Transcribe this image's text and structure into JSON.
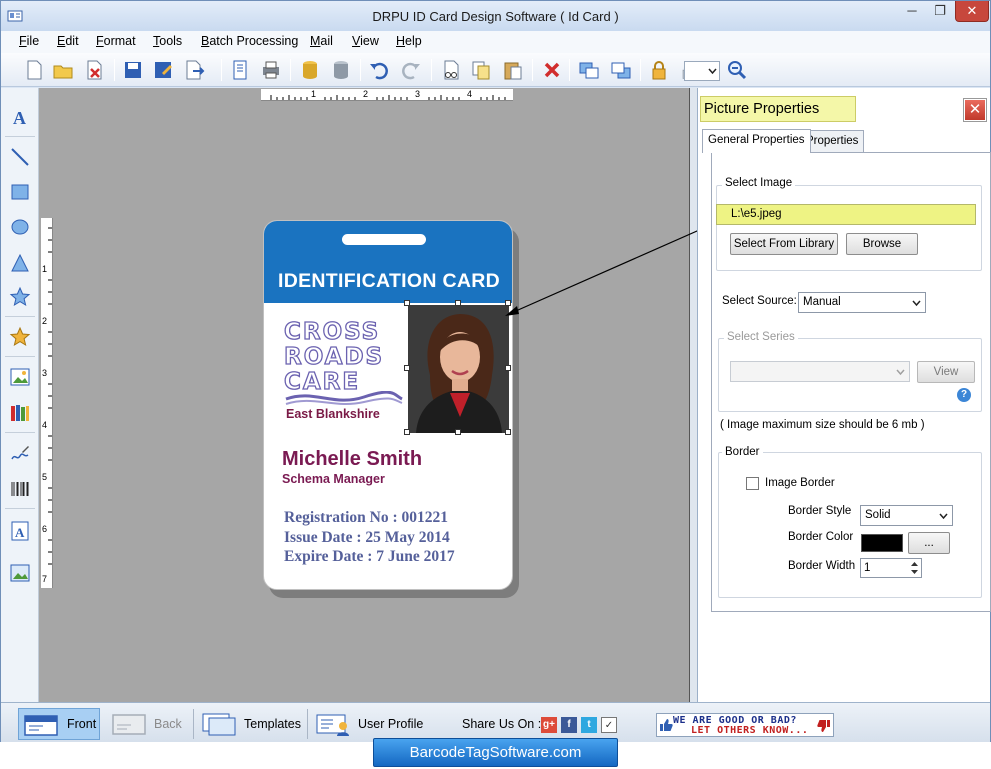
{
  "window": {
    "title": "DRPU ID Card Design Software ( Id Card )",
    "minimize": "─",
    "maximize": "❐",
    "close": "✕"
  },
  "menu": {
    "items": [
      {
        "first": "F",
        "rest": "ile"
      },
      {
        "first": "E",
        "rest": "dit"
      },
      {
        "first": "F",
        "rest": "ormat"
      },
      {
        "first": "T",
        "rest": "ools"
      },
      {
        "first": "B",
        "rest": "atch Processing"
      },
      {
        "first": "M",
        "rest": "ail"
      },
      {
        "first": "V",
        "rest": "iew"
      },
      {
        "first": "H",
        "rest": "elp"
      }
    ]
  },
  "ruler": {
    "h_numbers": [
      "1",
      "2",
      "3",
      "4"
    ],
    "v_numbers": [
      "1",
      "2",
      "3",
      "4",
      "5",
      "6",
      "7"
    ]
  },
  "card": {
    "title": "IDENTIFICATION CARD",
    "logo_lines": [
      "CROSS",
      "ROADS",
      "CARE"
    ],
    "logo_sub": "East Blankshire",
    "name": "Michelle Smith",
    "role": "Schema Manager",
    "registration": "Registration No : 001221",
    "issue": "Issue Date : 25 May 2014",
    "expire": "Expire Date : 7 June 2017"
  },
  "panel": {
    "title": "Picture Properties",
    "close": "✕",
    "tabs": [
      "General Properties",
      "Properties"
    ],
    "select_image_label": "Select Image",
    "path": "L:\\e5.jpeg",
    "select_from_library": "Select From Library",
    "browse": "Browse",
    "select_source_label": "Select Source:",
    "select_source_value": "Manual",
    "select_series_label": "Select Series",
    "view": "View",
    "help": "?",
    "max_size_note": "( Image maximum size should be 6 mb )",
    "border_label": "Border",
    "image_border_label": "Image Border",
    "border_style_label": "Border Style",
    "border_style_value": "Solid",
    "border_color_label": "Border Color",
    "border_color_value": "#000000",
    "border_color_button": "...",
    "border_width_label": "Border Width",
    "border_width_value": "1"
  },
  "bottombar": {
    "front": "Front",
    "back": "Back",
    "templates": "Templates",
    "user_profile": "User Profile",
    "share_label": "Share Us On :",
    "rate_line1": "WE ARE GOOD OR BAD?",
    "rate_line2": "LET OTHERS KNOW..."
  },
  "brand": "BarcodeTagSoftware.com",
  "colors": {
    "card_header": "#1a73c0",
    "card_name": "#7a1a52",
    "path_highlight": "#eef384",
    "panel_title_bg": "#f4f7a8"
  }
}
